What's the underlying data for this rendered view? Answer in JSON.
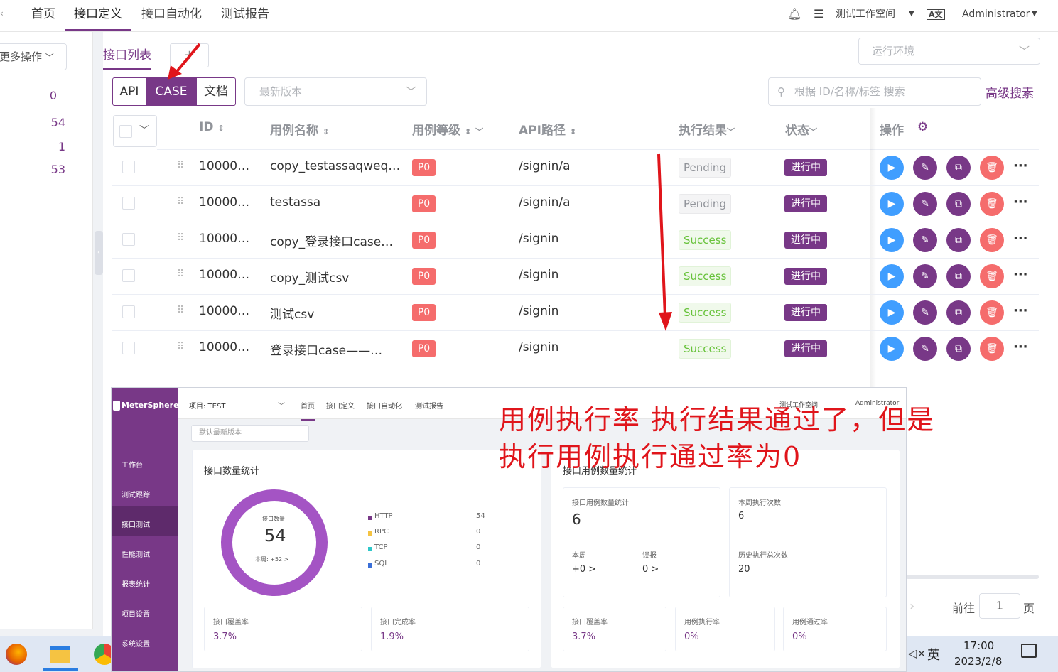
{
  "topnav": {
    "items": [
      "首页",
      "接口定义",
      "接口自动化",
      "测试报告"
    ],
    "active_index": 1,
    "workspace": "测试工作空间",
    "user": "Administrator"
  },
  "sidebar": {
    "more_ops": "更多操作",
    "counts": [
      "0",
      "54",
      "1",
      "53"
    ]
  },
  "main": {
    "tab_list": "接口列表",
    "tab_add": "+",
    "env_placeholder": "运行环境",
    "segments": [
      "API",
      "CASE",
      "文档"
    ],
    "segment_active": 1,
    "version_placeholder": "最新版本",
    "search_placeholder": "根据 ID/名称/标签 搜索",
    "advanced_search": "高级搜素",
    "columns": {
      "id": "ID",
      "name": "用例名称",
      "level": "用例等级",
      "path": "API路径",
      "result": "执行结果",
      "status": "状态",
      "ops": "操作"
    },
    "rows": [
      {
        "id": "10000…",
        "name": "copy_testassaqweq…",
        "level": "P0",
        "path": "/signin/a",
        "result": "Pending",
        "status": "进行中"
      },
      {
        "id": "10000…",
        "name": "testassa",
        "level": "P0",
        "path": "/signin/a",
        "result": "Pending",
        "status": "进行中"
      },
      {
        "id": "10000…",
        "name": "copy_登录接口case…",
        "level": "P0",
        "path": "/signin",
        "result": "Success",
        "status": "进行中"
      },
      {
        "id": "10000…",
        "name": "copy_测试csv",
        "level": "P0",
        "path": "/signin",
        "result": "Success",
        "status": "进行中"
      },
      {
        "id": "10000…",
        "name": "测试csv",
        "level": "P0",
        "path": "/signin",
        "result": "Success",
        "status": "进行中"
      },
      {
        "id": "10000…",
        "name": "登录接口case——…",
        "level": "P0",
        "path": "/signin",
        "result": "Success",
        "status": "进行中"
      }
    ],
    "pagination": {
      "goto": "前往",
      "page": "1",
      "page_suffix": "页"
    }
  },
  "overlay": {
    "brand": "MeterSphere",
    "project": "项目: TEST",
    "nav": [
      "首页",
      "接口定义",
      "接口自动化",
      "测试报告"
    ],
    "header_right": "测试工作空间",
    "header_user": "Administrator",
    "side_items": [
      "工作台",
      "测试跟踪",
      "接口测试",
      "性能测试",
      "报表统计",
      "项目设置",
      "系统设置"
    ],
    "side_active": 2,
    "version": "默认最新版本",
    "api_stats": {
      "title": "接口数量统计",
      "donut_label": "接口数量",
      "donut_value": "54",
      "donut_week": "本周: +52 >",
      "legend": [
        {
          "name": "HTTP",
          "value": "54",
          "color": "#783887"
        },
        {
          "name": "RPC",
          "value": "0",
          "color": "#f5c342"
        },
        {
          "name": "TCP",
          "value": "0",
          "color": "#2ec7c9"
        },
        {
          "name": "SQL",
          "value": "0",
          "color": "#3a6fd8"
        }
      ],
      "coverage_label": "接口覆盖率",
      "coverage_value": "3.7%",
      "completion_label": "接口完成率",
      "completion_value": "1.9%"
    },
    "case_stats": {
      "title": "接口用例数量统计",
      "count_label": "接口用例数量统计",
      "count_value": "6",
      "week_label": "本周",
      "week_value": "+0 >",
      "misreport_label": "误报",
      "misreport_value": "0 >",
      "exec_week_label": "本周执行次数",
      "exec_week_value": "6",
      "exec_total_label": "历史执行总次数",
      "exec_total_value": "20",
      "coverage_label": "接口覆盖率",
      "coverage_value": "3.7%",
      "exec_rate_label": "用例执行率",
      "exec_rate_value": "0%",
      "pass_rate_label": "用例通过率",
      "pass_rate_value": "0%"
    }
  },
  "annotation": {
    "line1": "用例执行率 执行结果通过了，但是",
    "line2": "执行用例执行通过率为0"
  },
  "taskbar": {
    "ime": "英",
    "volume": "◁×",
    "time": "17:00",
    "date": "2023/2/8"
  }
}
